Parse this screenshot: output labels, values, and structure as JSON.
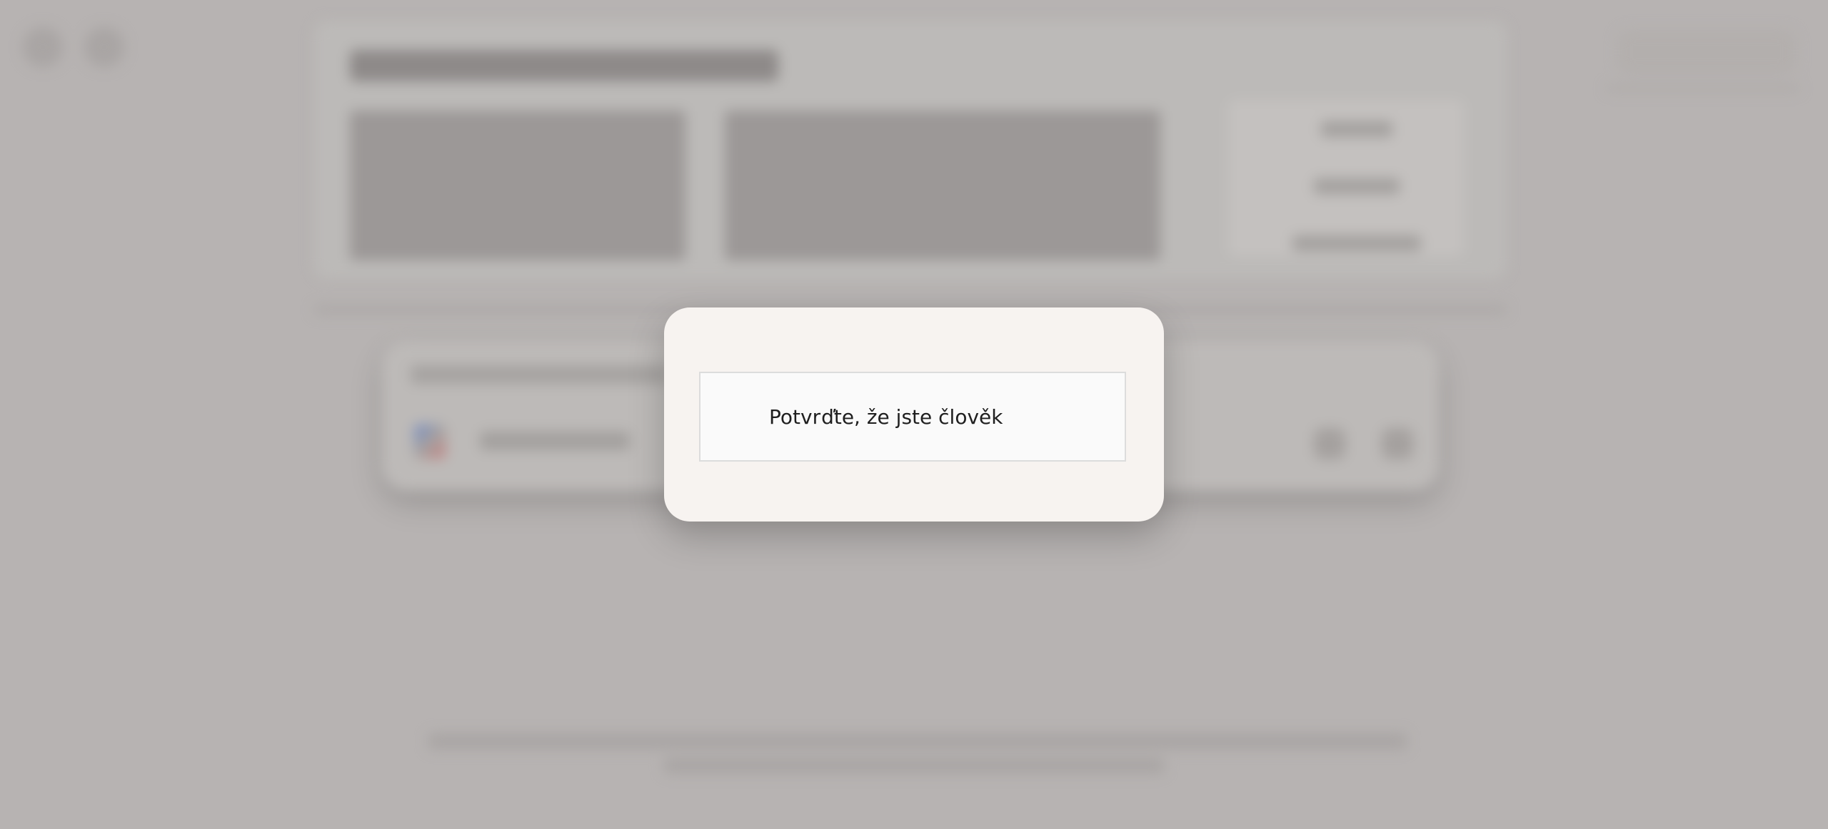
{
  "captcha": {
    "label": "Potvrďte, že jste člověk"
  },
  "icons": {
    "sidebar_toggle": "sidebar-icon",
    "new_chat": "new-chat-icon",
    "model_logo": "model-logo-icon",
    "attach": "attach-icon",
    "submit": "send-icon",
    "account": "account-icon"
  },
  "colors": {
    "overlay_bg": "#b7b3b2",
    "modal_bg": "#f7f3f0",
    "widget_bg": "#fafafa",
    "widget_border": "#dcdcdc",
    "text": "#1f1f1f"
  }
}
